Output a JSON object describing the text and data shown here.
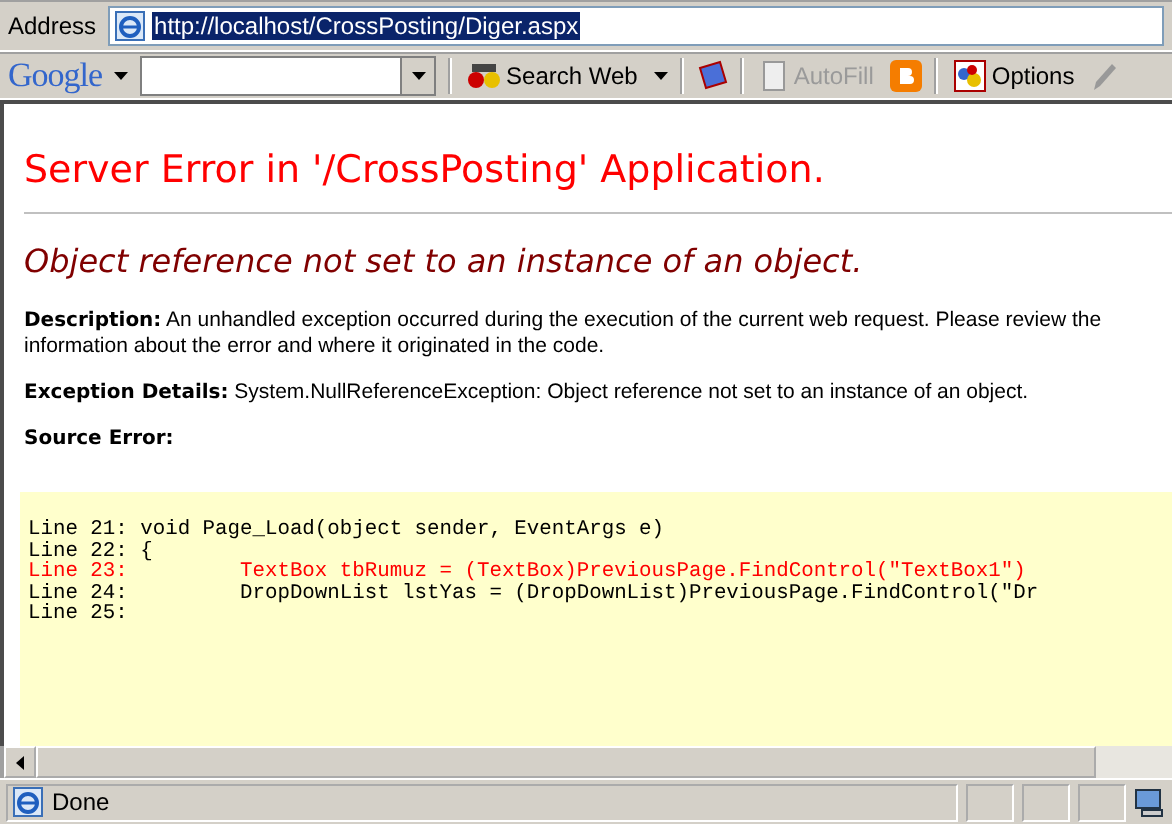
{
  "address_bar": {
    "label": "Address",
    "url": "http://localhost/CrossPosting/Diger.aspx"
  },
  "google_toolbar": {
    "logo": "Google",
    "search_button": "Search Web",
    "autofill": {
      "label": "AutoFill",
      "disabled": true
    },
    "options": "Options"
  },
  "page": {
    "title": "Server Error in '/CrossPosting' Application.",
    "error_message": "Object reference not set to an instance of an object.",
    "description": {
      "label": "Description:",
      "lines": [
        "An unhandled exception occurred during the execution of the current web request. Please review the",
        "information about the error and where it originated in the code."
      ]
    },
    "exception_details": {
      "label": "Exception Details:",
      "text": "System.NullReferenceException: Object reference not set to an instance of an object."
    },
    "source_error_label": "Source Error:",
    "source_lines": [
      {
        "number": "Line 21:",
        "code": "void Page_Load(object sender, EventArgs e)",
        "error": false
      },
      {
        "number": "Line 22:",
        "code": "{",
        "error": false
      },
      {
        "number": "Line 23:",
        "code": "        TextBox tbRumuz = (TextBox)PreviousPage.FindControl(\"TextBox1\")",
        "error": true
      },
      {
        "number": "Line 24:",
        "code": "        DropDownList lstYas = (DropDownList)PreviousPage.FindControl(\"Dr",
        "error": false
      },
      {
        "number": "Line 25:",
        "error": false
      }
    ]
  },
  "status_bar": {
    "text": "Done"
  }
}
